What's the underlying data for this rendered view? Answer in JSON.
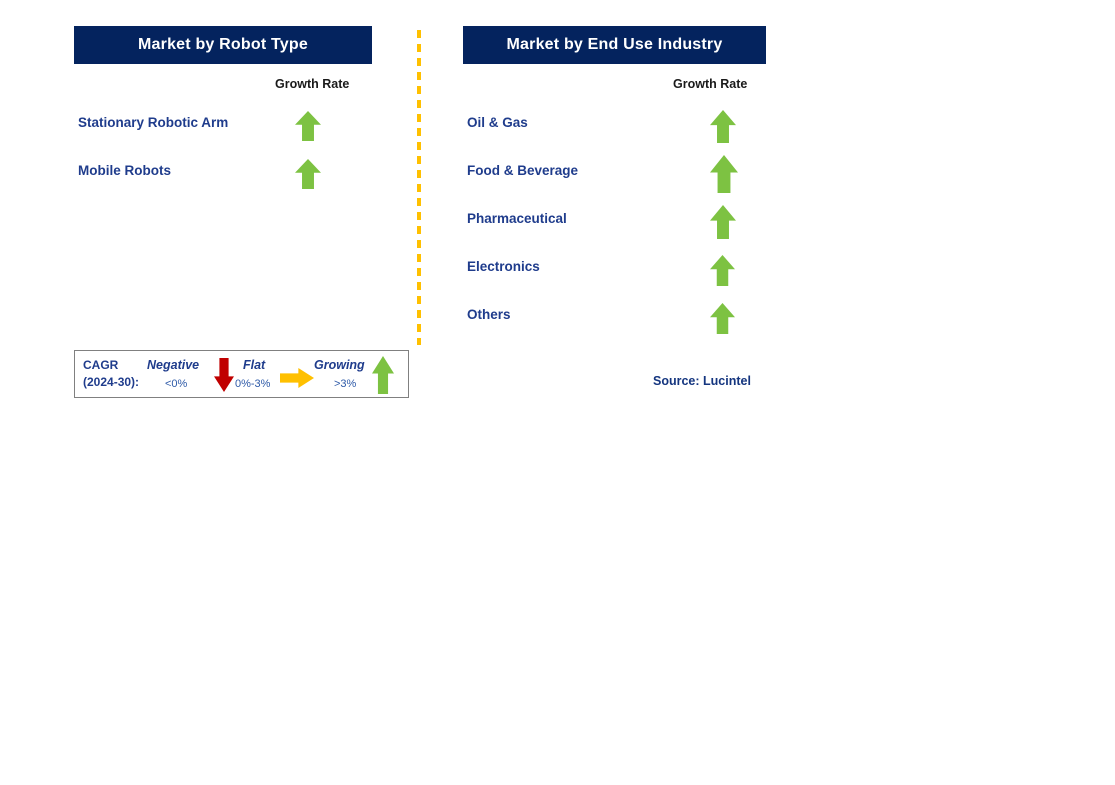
{
  "panels": [
    {
      "id": "robot-type",
      "title": "Market by Robot Type",
      "growth_rate_header": "Growth Rate",
      "rows": [
        {
          "label": "Stationary Robotic Arm",
          "trend": "growing",
          "icon": "arrow-up-icon",
          "arrow_width": 26,
          "arrow_height": 30
        },
        {
          "label": "Mobile Robots",
          "trend": "growing",
          "icon": "arrow-up-icon",
          "arrow_width": 26,
          "arrow_height": 30
        }
      ]
    },
    {
      "id": "end-use",
      "title": "Market by End Use Industry",
      "growth_rate_header": "Growth Rate",
      "rows": [
        {
          "label": "Oil & Gas",
          "trend": "growing",
          "icon": "arrow-up-icon",
          "arrow_width": 26,
          "arrow_height": 33
        },
        {
          "label": "Food & Beverage",
          "trend": "growing",
          "icon": "arrow-up-icon",
          "arrow_width": 28,
          "arrow_height": 38
        },
        {
          "label": "Pharmaceutical",
          "trend": "growing",
          "icon": "arrow-up-icon",
          "arrow_width": 26,
          "arrow_height": 34
        },
        {
          "label": "Electronics",
          "trend": "growing",
          "icon": "arrow-up-icon",
          "arrow_width": 25,
          "arrow_height": 31
        },
        {
          "label": "Others",
          "trend": "growing",
          "icon": "arrow-up-icon",
          "arrow_width": 25,
          "arrow_height": 31
        }
      ]
    }
  ],
  "legend": {
    "title_line1": "CAGR",
    "title_line2": "(2024-30):",
    "items": [
      {
        "term": "Negative",
        "range": "<0%",
        "icon": "arrow-down-icon",
        "color": "#C00000"
      },
      {
        "term": "Flat",
        "range": "0%-3%",
        "icon": "arrow-right-icon",
        "color": "#FFC000"
      },
      {
        "term": "Growing",
        "range": ">3%",
        "icon": "arrow-up-icon",
        "color": "#7DC242"
      }
    ]
  },
  "source": "Source: Lucintel",
  "colors": {
    "header_navy": "#04235E",
    "label_blue": "#1F3C8C",
    "growing_green": "#7DC242",
    "negative_red": "#C00000",
    "flat_orange": "#FFC000",
    "divider_orange": "#FFC000",
    "legend_border": "#808080"
  }
}
